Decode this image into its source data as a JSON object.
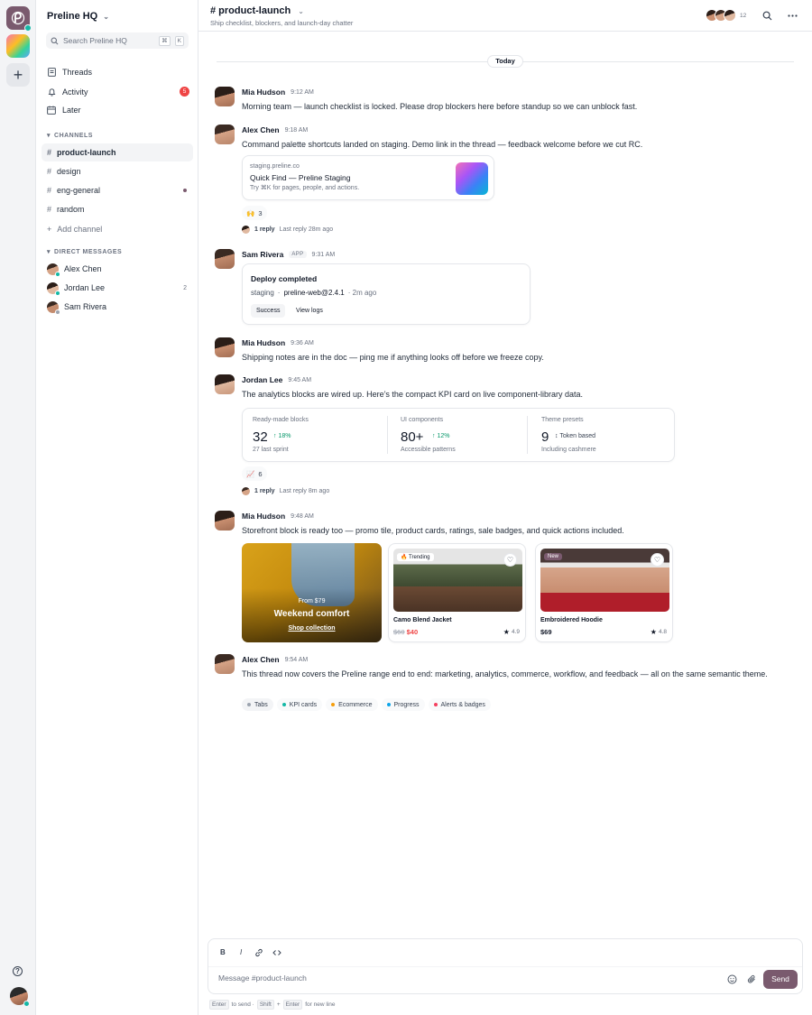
{
  "workspace": {
    "name": "Preline HQ",
    "search_placeholder": "Search Preline HQ",
    "search_kbd": [
      "⌘",
      "K"
    ]
  },
  "nav": [
    {
      "label": "Threads",
      "icon": "threads-icon"
    },
    {
      "label": "Activity",
      "icon": "bell-icon",
      "badge": "5"
    },
    {
      "label": "Later",
      "icon": "calendar-icon"
    }
  ],
  "channels": {
    "heading": "CHANNELS",
    "items": [
      {
        "label": "product-launch",
        "active": true
      },
      {
        "label": "design"
      },
      {
        "label": "eng-general",
        "unread": true
      },
      {
        "label": "random"
      }
    ],
    "add_label": "Add channel"
  },
  "dms": {
    "heading": "DIRECT MESSAGES",
    "items": [
      {
        "label": "Alex Chen",
        "status": "online"
      },
      {
        "label": "Jordan Lee",
        "status": "online",
        "count": "2"
      },
      {
        "label": "Sam Rivera",
        "status": "away"
      }
    ]
  },
  "header": {
    "title": "# product-launch",
    "description": "Ship checklist, blockers, and launch-day chatter",
    "member_count": "12"
  },
  "divider": {
    "label": "Today"
  },
  "messages": [
    {
      "name": "Mia Hudson",
      "time": "9:12 AM",
      "text": "Morning team — launch checklist is locked. Please drop blockers here before standup so we can unblock fast."
    },
    {
      "name": "Alex Chen",
      "time": "9:18 AM",
      "text": "Command palette shortcuts landed on staging. Demo link in the thread — feedback welcome before we cut RC.",
      "link": {
        "domain": "staging.preline.co",
        "title": "Quick Find — Preline Staging",
        "desc": "Try ⌘K for pages, people, and actions."
      },
      "reaction": {
        "emoji": "🙌",
        "count": "3"
      },
      "thread": {
        "replies": "1 reply",
        "last": "Last reply 28m ago"
      }
    },
    {
      "name": "Sam Rivera",
      "badge": "APP",
      "time": "9:31 AM",
      "deploy": {
        "title": "Deploy completed",
        "env": "staging",
        "version": "preline-web@2.4.1",
        "ago": "· 2m ago",
        "actions": [
          "Success",
          "View logs"
        ]
      }
    },
    {
      "name": "Mia Hudson",
      "time": "9:36 AM",
      "text": "Shipping notes are in the doc — ping me if anything looks off before we freeze copy."
    },
    {
      "name": "Jordan Lee",
      "time": "9:45 AM",
      "text": "The analytics blocks are wired up. Here’s the compact KPI card on live component-library data.",
      "kpis": [
        {
          "label": "Ready-made blocks",
          "value": "32",
          "delta": "↑ 18%",
          "sub": "27 last sprint"
        },
        {
          "label": "UI components",
          "value": "80+",
          "delta": "↑ 12%",
          "sub": "Accessible patterns"
        },
        {
          "label": "Theme presets",
          "value": "9",
          "note": "↕ Token based",
          "sub": "Including cashmere"
        }
      ],
      "reaction": {
        "emoji": "📈",
        "count": "6"
      },
      "thread": {
        "replies": "1 reply",
        "last": "Last reply 8m ago"
      }
    },
    {
      "name": "Mia Hudson",
      "time": "9:48 AM",
      "text": "Storefront block is ready too — promo tile, product cards, ratings, sale badges, and quick actions included.",
      "promo": {
        "price": "From $79",
        "title": "Weekend comfort",
        "cta": "Shop collection"
      },
      "products": [
        {
          "tag": "🔥 Trending",
          "name": "Camo Blend Jacket",
          "old_price": "$60",
          "price": "$40",
          "rating": "4.9"
        },
        {
          "tag": "New",
          "name": "Embroidered Hoodie",
          "price": "$69",
          "rating": "4.8"
        }
      ]
    },
    {
      "name": "Alex Chen",
      "time": "9:54 AM",
      "text": "This thread now covers the Preline range end to end: marketing, analytics, commerce, workflow, and feedback — all on the same semantic theme.",
      "chips": [
        {
          "label": "Tabs",
          "color": "#9ca3af"
        },
        {
          "label": "KPI cards",
          "color": "#14b8a6"
        },
        {
          "label": "Ecommerce",
          "color": "#f59e0b"
        },
        {
          "label": "Progress",
          "color": "#0ea5e9"
        },
        {
          "label": "Alerts & badges",
          "color": "#f43f5e"
        }
      ]
    }
  ],
  "composer": {
    "placeholder": "Message #product-launch",
    "send": "Send",
    "toolbar": [
      "B",
      "I"
    ]
  },
  "hint": {
    "k1": "Enter",
    "t1": "to send ·",
    "k2": "Shift",
    "t2": "+",
    "k3": "Enter",
    "t3": "for new line"
  },
  "colors": {
    "brand": "#7a5a6e",
    "badge": "#ef4444",
    "online": "#14b8a6",
    "away": "#9ca3af",
    "delta": "#059669"
  }
}
